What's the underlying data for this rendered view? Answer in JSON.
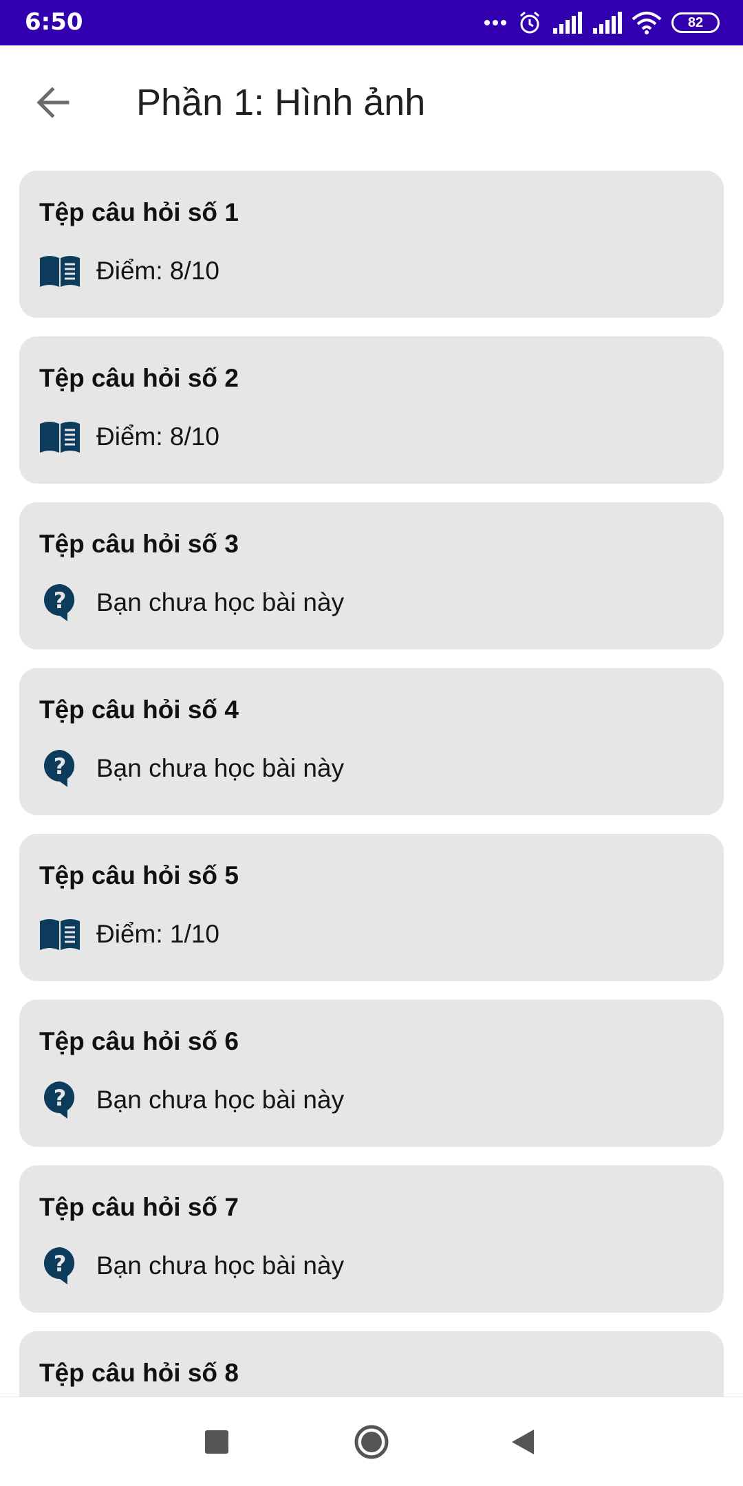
{
  "status_bar": {
    "time": "6:50",
    "battery": "82",
    "icons": [
      "more-dots-icon",
      "alarm-icon",
      "signal-icon",
      "signal-icon",
      "wifi-icon",
      "battery-icon"
    ]
  },
  "header": {
    "title": "Phần 1: Hình ảnh",
    "back_icon": "arrow-left-icon"
  },
  "cards": [
    {
      "title": "Tệp câu hỏi số 1",
      "status": "Điểm: 8/10",
      "icon": "book-icon"
    },
    {
      "title": "Tệp câu hỏi số 2",
      "status": "Điểm: 8/10",
      "icon": "book-icon"
    },
    {
      "title": "Tệp câu hỏi số 3",
      "status": "Bạn chưa học bài này",
      "icon": "question-icon"
    },
    {
      "title": "Tệp câu hỏi số 4",
      "status": "Bạn chưa học bài này",
      "icon": "question-icon"
    },
    {
      "title": "Tệp câu hỏi số 5",
      "status": "Điểm: 1/10",
      "icon": "book-icon"
    },
    {
      "title": "Tệp câu hỏi số 6",
      "status": "Bạn chưa học bài này",
      "icon": "question-icon"
    },
    {
      "title": "Tệp câu hỏi số 7",
      "status": "Bạn chưa học bài này",
      "icon": "question-icon"
    },
    {
      "title": "Tệp câu hỏi số 8",
      "status": "",
      "icon": ""
    }
  ],
  "nav_bar": {
    "buttons": [
      "recents-square-icon",
      "home-circle-icon",
      "back-triangle-icon"
    ]
  },
  "colors": {
    "status_bar": "#3300b0",
    "card_background": "#e6e6e6",
    "icon_color": "#0d3b5c",
    "nav_icon": "#555555"
  }
}
